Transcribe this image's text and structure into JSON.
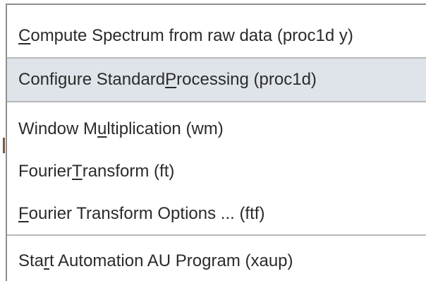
{
  "menu": {
    "items": [
      {
        "pre": "",
        "mn": "C",
        "post": "ompute Spectrum from raw data (proc1d y)",
        "highlighted": false
      },
      {
        "pre": "Configure Standard ",
        "mn": "P",
        "post": "rocessing (proc1d)",
        "highlighted": true
      },
      {
        "pre": "Window M",
        "mn": "u",
        "post": "ltiplication (wm)",
        "highlighted": false
      },
      {
        "pre": "Fourier ",
        "mn": "T",
        "post": "ransform (ft)",
        "highlighted": false
      },
      {
        "pre": "",
        "mn": "F",
        "post": "ourier Transform Options ... (ftf)",
        "highlighted": false
      },
      {
        "pre": "Sta",
        "mn": "r",
        "post": "t Automation AU Program (xaup)",
        "highlighted": false
      }
    ]
  },
  "colors": {
    "highlight": "#dfe4ea",
    "text": "#2b2b2b",
    "separator": "#b8b8b8"
  }
}
